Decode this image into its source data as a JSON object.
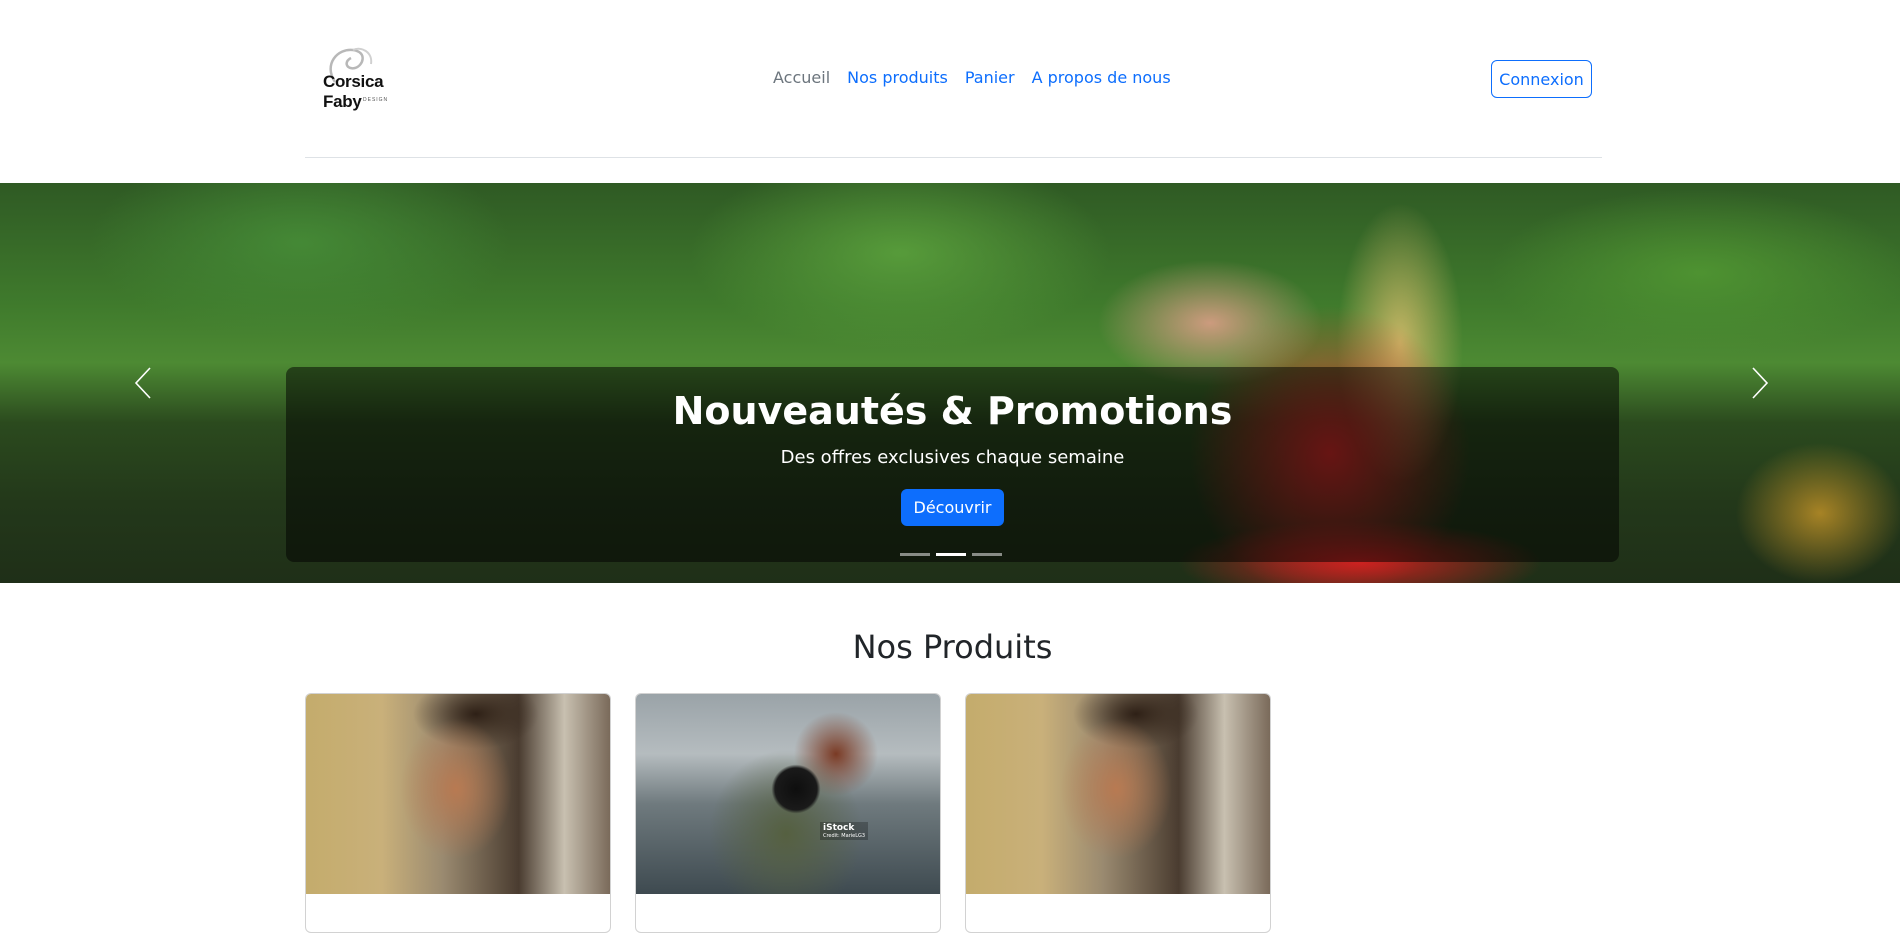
{
  "brand": {
    "name": "Corsica Faby",
    "tagline": "DESIGN"
  },
  "nav": {
    "items": [
      {
        "label": "Accueil",
        "active": true
      },
      {
        "label": "Nos produits",
        "active": false
      },
      {
        "label": "Panier",
        "active": false
      },
      {
        "label": "A propos de nous",
        "active": false
      }
    ],
    "login_label": "Connexion"
  },
  "carousel": {
    "caption_title": "Nouveautés & Promotions",
    "caption_text": "Des offres exclusives chaque semaine",
    "button_label": "Découvrir",
    "slide_count": 3,
    "active_slide": 2,
    "prev_icon": "chevron-left-icon",
    "next_icon": "chevron-right-icon"
  },
  "products": {
    "title": "Nos Produits",
    "watermark": {
      "brand": "iStock",
      "credit": "Credit: MarieLG3"
    }
  },
  "colors": {
    "primary": "#0d6efd",
    "muted": "#6c757d",
    "text": "#212529"
  }
}
